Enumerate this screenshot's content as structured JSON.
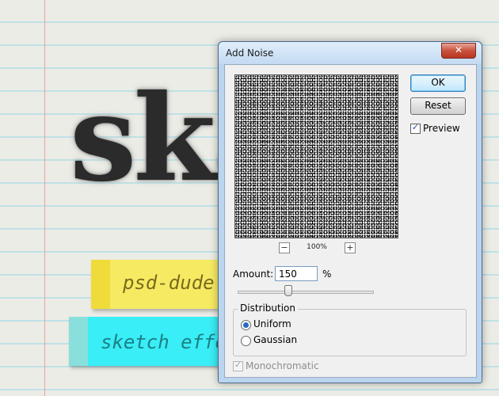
{
  "background": {
    "big_word": "skε",
    "notes": [
      {
        "text": "psd-dude",
        "color": "#f6ea63"
      },
      {
        "text": "sketch effe",
        "color": "#39eef6"
      }
    ]
  },
  "dialog": {
    "title": "Add Noise",
    "close_glyph": "✕",
    "buttons": {
      "ok": "OK",
      "reset": "Reset"
    },
    "preview_checkbox": {
      "label": "Preview",
      "checked": true,
      "check_glyph": "✓"
    },
    "zoom": {
      "minus": "−",
      "plus": "+",
      "level": "100%"
    },
    "amount": {
      "label": "Amount:",
      "value": "150",
      "unit": "%",
      "slider_fraction": 0.375
    },
    "distribution": {
      "title": "Distribution",
      "options": [
        {
          "label": "Uniform",
          "selected": true
        },
        {
          "label": "Gaussian",
          "selected": false
        }
      ]
    },
    "monochromatic": {
      "label": "Monochromatic",
      "checked": true,
      "enabled": false,
      "check_glyph": "✓"
    }
  },
  "colors": {
    "ok_border": "#3c7fb1",
    "radio_dot": "#2869c5"
  }
}
